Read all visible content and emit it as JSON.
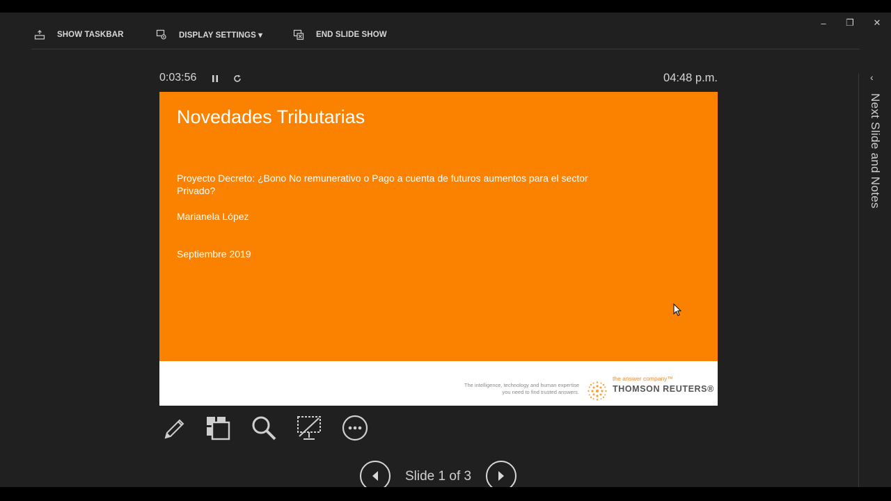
{
  "toolbar": {
    "show_taskbar": "SHOW TASKBAR",
    "display_settings": "DISPLAY SETTINGS ▾",
    "end_slide_show": "END SLIDE SHOW"
  },
  "window_controls": {
    "minimize": "–",
    "restore": "❐",
    "close": "✕"
  },
  "timer": {
    "elapsed": "0:03:56",
    "clock": "04:48 p.m."
  },
  "slide": {
    "title": "Novedades Tributarias",
    "line1": "Proyecto  Decreto: ¿Bono No remunerativo o Pago a cuenta de futuros aumentos para el sector",
    "line2": "Privado?",
    "author": "Marianela López",
    "date": "Septiembre 2019",
    "footer": {
      "tagline_1": "The intelligence, technology and human expertise",
      "tagline_2": "you need to find trusted answers.",
      "answer_company": "the answer company™",
      "brand": "THOMSON REUTERS®"
    },
    "background_color": "#fb8200"
  },
  "tools": [
    "pen-icon",
    "see-all-slides-icon",
    "zoom-icon",
    "black-screen-icon",
    "more-options-icon"
  ],
  "navigation": {
    "counter": "Slide 1 of 3"
  },
  "side_panel": {
    "label": "Next Slide and Notes",
    "chevron": "‹"
  }
}
